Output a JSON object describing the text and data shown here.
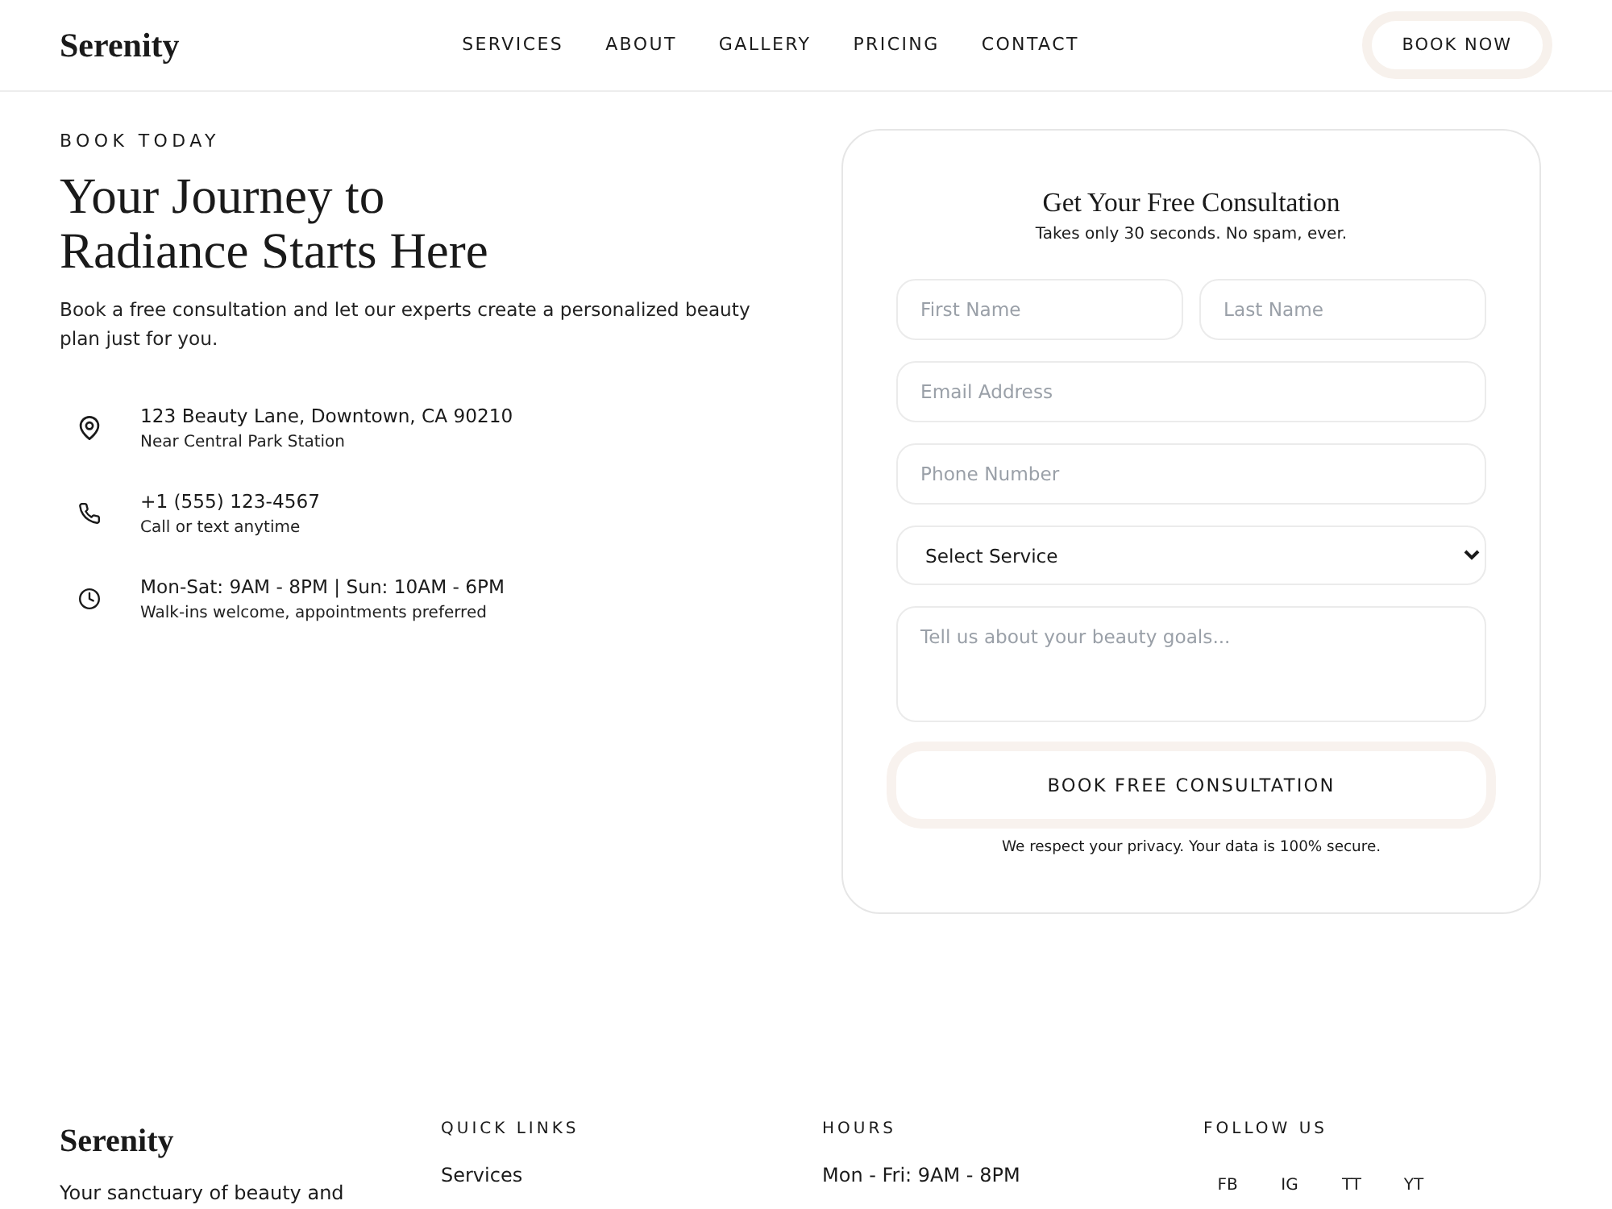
{
  "header": {
    "logo": "Serenity",
    "nav": [
      {
        "label": "SERVICES"
      },
      {
        "label": "ABOUT"
      },
      {
        "label": "GALLERY"
      },
      {
        "label": "PRICING"
      },
      {
        "label": "CONTACT"
      }
    ],
    "cta": "BOOK NOW"
  },
  "hero": {
    "eyebrow": "BOOK TODAY",
    "title": "Your Journey to Radiance Starts Here",
    "description": "Book a free consultation and let our experts create a personalized beauty plan just for you.",
    "contacts": [
      {
        "kind": "location",
        "primary": "123 Beauty Lane, Downtown, CA 90210",
        "secondary": "Near Central Park Station"
      },
      {
        "kind": "phone",
        "primary": "+1 (555) 123-4567",
        "secondary": "Call or text anytime"
      },
      {
        "kind": "hours",
        "primary": "Mon-Sat: 9AM - 8PM | Sun: 10AM - 6PM",
        "secondary": "Walk-ins welcome, appointments preferred"
      }
    ]
  },
  "form": {
    "title": "Get Your Free Consultation",
    "subtitle": "Takes only 30 seconds. No spam, ever.",
    "rows": [
      {
        "fields": [
          {
            "kind": "input",
            "placeholder": "First Name"
          },
          {
            "kind": "input",
            "placeholder": "Last Name"
          }
        ]
      },
      {
        "fields": [
          {
            "kind": "input",
            "placeholder": "Email Address"
          }
        ]
      },
      {
        "fields": [
          {
            "kind": "input",
            "placeholder": "Phone Number"
          }
        ]
      },
      {
        "fields": [
          {
            "kind": "select",
            "value": "Select Service"
          }
        ]
      },
      {
        "fields": [
          {
            "kind": "textarea",
            "placeholder": "Tell us about your beauty goals..."
          }
        ]
      }
    ],
    "submit": "BOOK FREE CONSULTATION",
    "note": "We respect your privacy. Your data is 100% secure."
  },
  "footer": {
    "logo": "Serenity",
    "tagline": "Your sanctuary of beauty and",
    "columns": [
      {
        "heading": "QUICK LINKS",
        "items": [
          "Services"
        ]
      },
      {
        "heading": "HOURS",
        "items": [
          "Mon - Fri: 9AM - 8PM"
        ]
      }
    ],
    "social": {
      "heading": "FOLLOW US",
      "links": [
        "FB",
        "IG",
        "TT",
        "YT"
      ]
    }
  }
}
